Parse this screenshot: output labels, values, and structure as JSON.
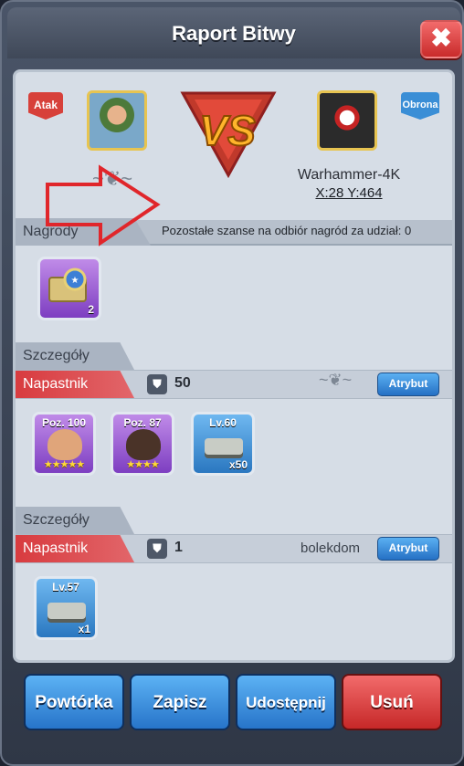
{
  "window": {
    "title": "Raport Bitwy",
    "close_label": "✖"
  },
  "attacker": {
    "badge": "Atak",
    "icon": "soldier-avatar"
  },
  "defender": {
    "badge": "Obrona",
    "name": "Warhammer-4K",
    "coords": "X:28 Y:464",
    "icon": "robot-avatar"
  },
  "vs_label": "VS",
  "rewards": {
    "tab": "Nagrody",
    "note": "Pozostałe szanse na odbiór nagród za udział: 0",
    "items": [
      {
        "icon": "medal-ticket-icon",
        "count": "2"
      }
    ]
  },
  "details": [
    {
      "tab": "Szczegóły",
      "role": "Napastnik",
      "power": "50",
      "player": "",
      "attr_label": "Atrybut",
      "units": [
        {
          "label": "Poz. 100",
          "stars": "★★★★★",
          "color": "purple"
        },
        {
          "label": "Poz. 87",
          "stars": "★★★★",
          "color": "purple"
        },
        {
          "label": "Lv.60",
          "count": "x50",
          "color": "blue"
        }
      ]
    },
    {
      "tab": "Szczegóły",
      "role": "Napastnik",
      "power": "1",
      "player": "bolekdom",
      "attr_label": "Atrybut",
      "units": [
        {
          "label": "Lv.57",
          "count": "x1",
          "color": "blue"
        }
      ]
    }
  ],
  "buttons": {
    "replay": "Powtórka",
    "save": "Zapisz",
    "share": "Udostępnij",
    "delete": "Usuń"
  },
  "colors": {
    "accent_blue": "#2774c9",
    "danger_red": "#c62828",
    "highlight_arrow": "#e0262b"
  }
}
